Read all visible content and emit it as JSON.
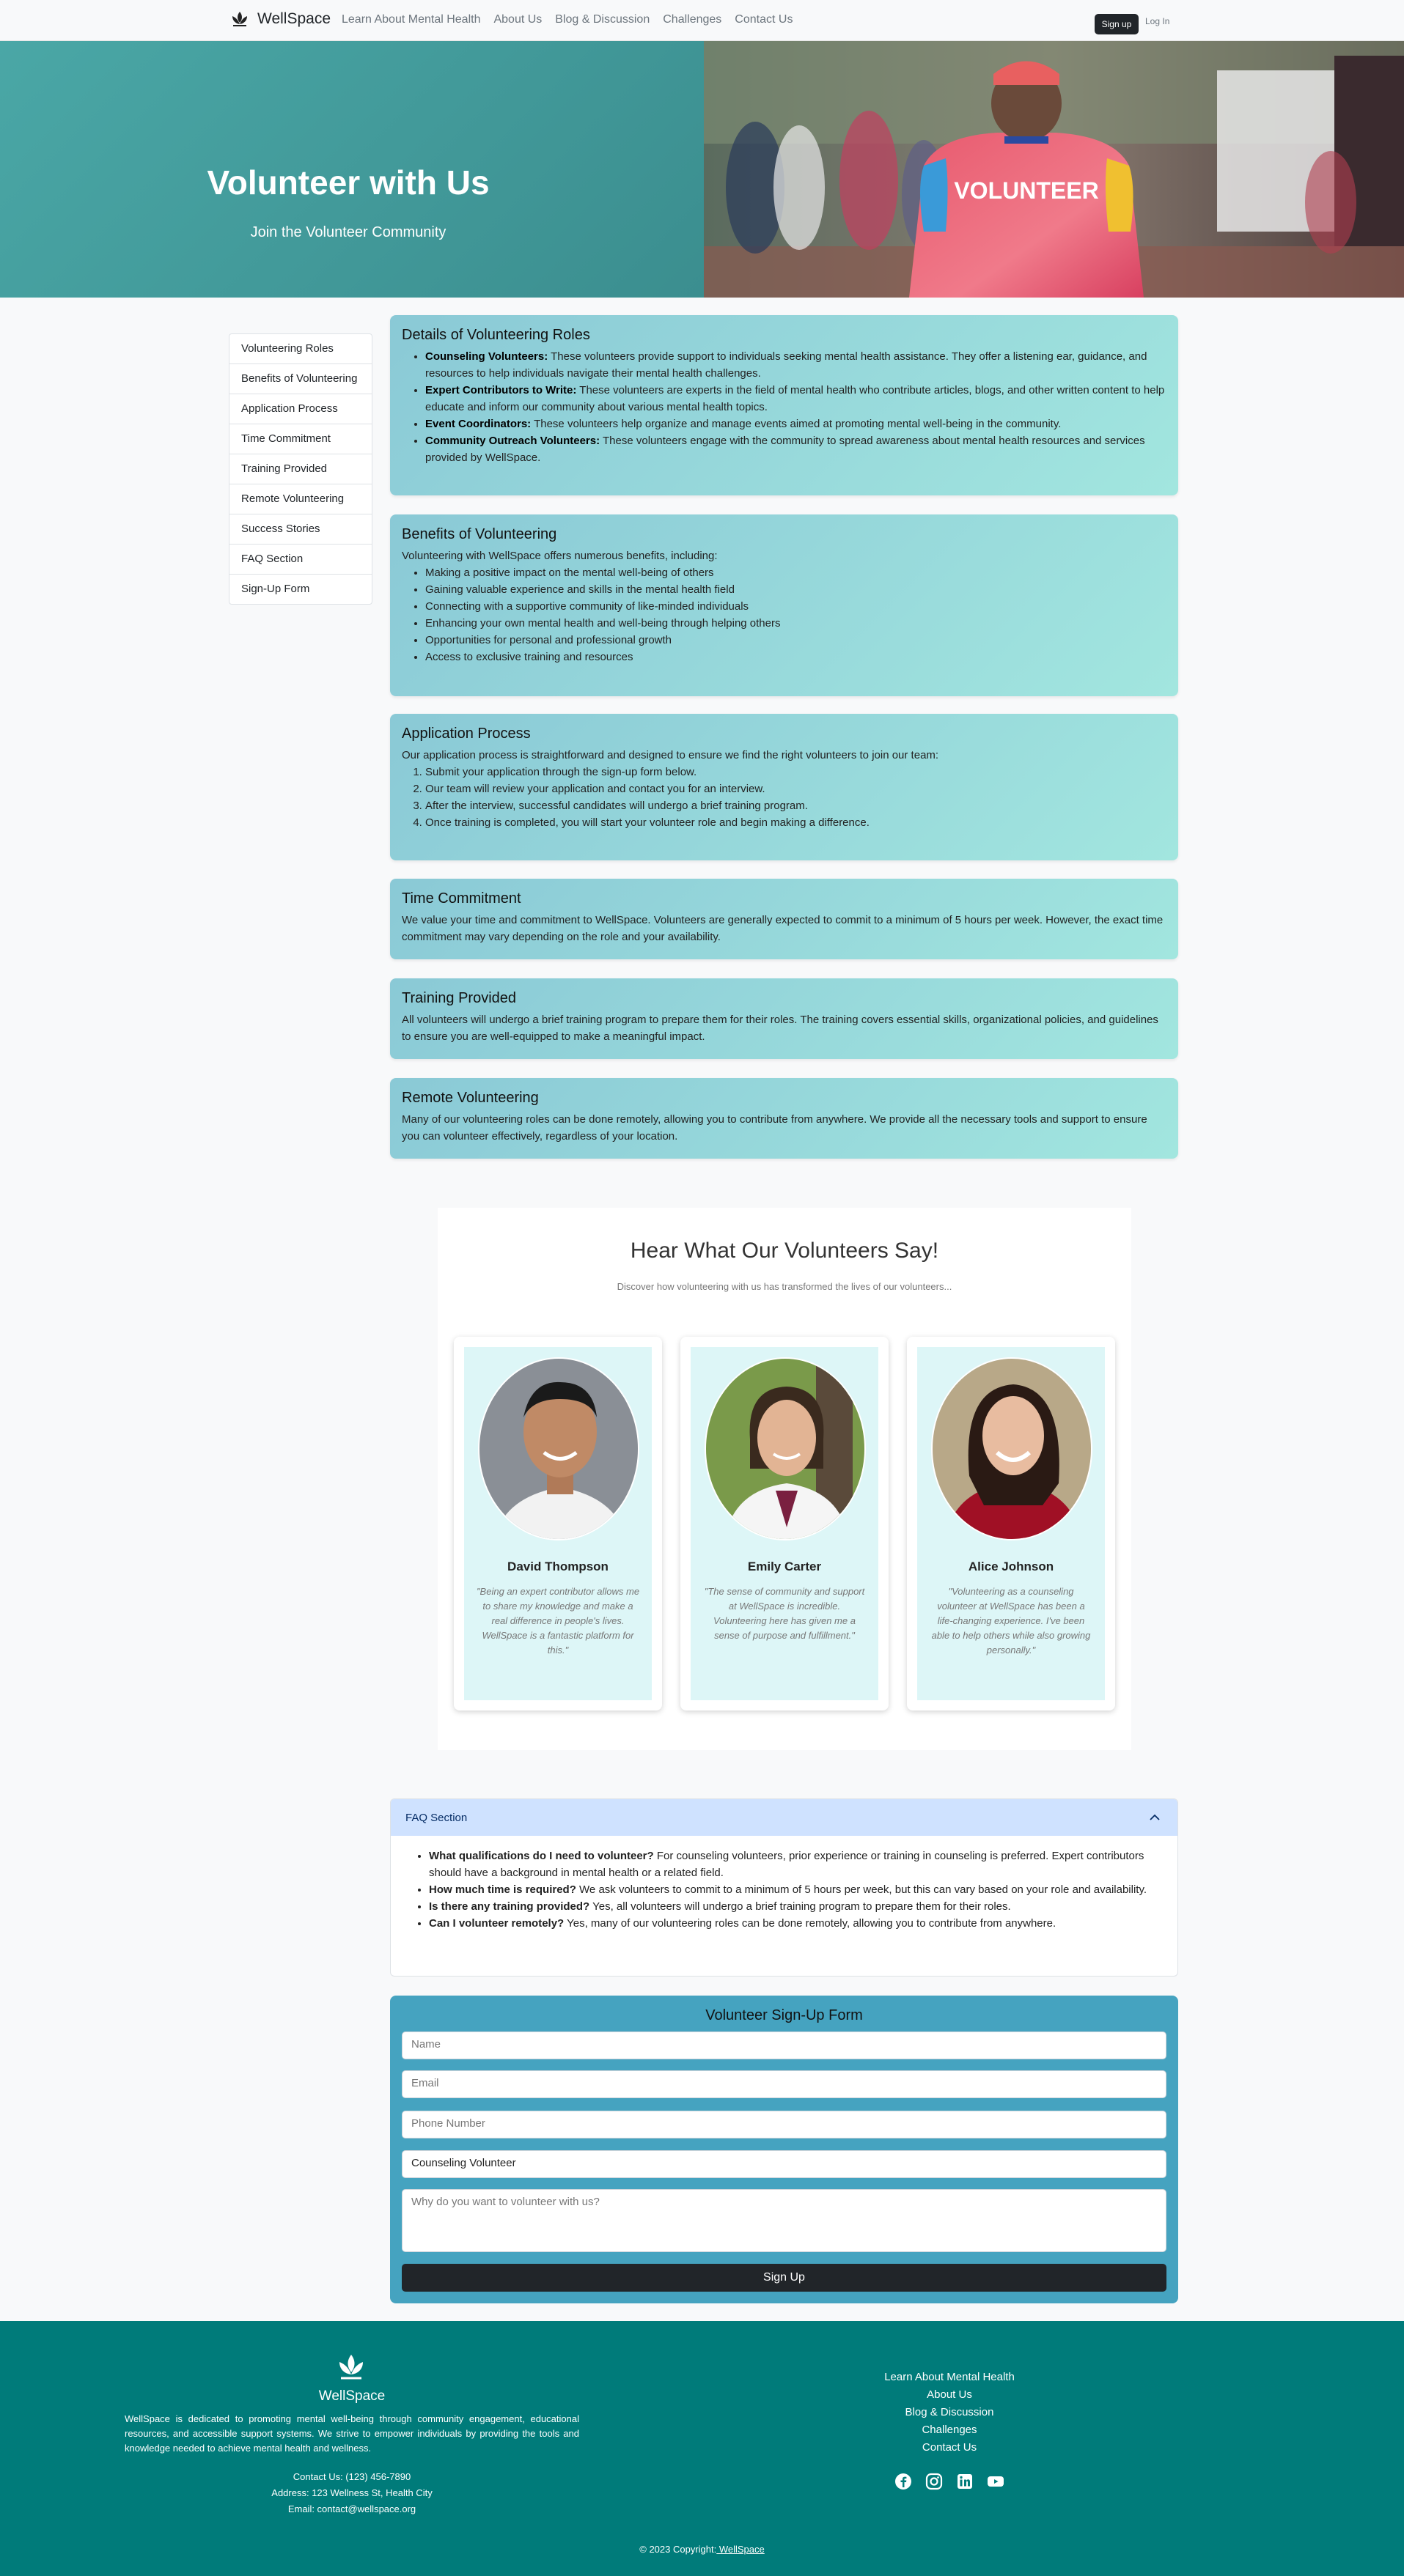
{
  "nav": {
    "brand": "WellSpace",
    "links": [
      "Learn About Mental Health",
      "About Us",
      "Blog & Discussion",
      "Challenges",
      "Contact Us"
    ],
    "signup": "Sign up",
    "login": "Log In"
  },
  "hero": {
    "title": "Volunteer with Us",
    "subtitle": "Join the Volunteer Community",
    "image_text": "VOLUNTEER"
  },
  "sidebar": [
    "Volunteering Roles",
    "Benefits of Volunteering",
    "Application Process",
    "Time Commitment",
    "Training Provided",
    "Remote Volunteering",
    "Success Stories",
    "FAQ Section",
    "Sign-Up Form"
  ],
  "roles": {
    "title": "Details of Volunteering Roles",
    "items": [
      {
        "term": "Counseling Volunteers:",
        "text": " These volunteers provide support to individuals seeking mental health assistance. They offer a listening ear, guidance, and resources to help individuals navigate their mental health challenges."
      },
      {
        "term": "Expert Contributors to Write:",
        "text": " These volunteers are experts in the field of mental health who contribute articles, blogs, and other written content to help educate and inform our community about various mental health topics."
      },
      {
        "term": "Event Coordinators:",
        "text": " These volunteers help organize and manage events aimed at promoting mental well-being in the community."
      },
      {
        "term": "Community Outreach Volunteers:",
        "text": " These volunteers engage with the community to spread awareness about mental health resources and services provided by WellSpace."
      }
    ]
  },
  "benefits": {
    "title": "Benefits of Volunteering",
    "intro": "Volunteering with WellSpace offers numerous benefits, including:",
    "items": [
      "Making a positive impact on the mental well-being of others",
      "Gaining valuable experience and skills in the mental health field",
      "Connecting with a supportive community of like-minded individuals",
      "Enhancing your own mental health and well-being through helping others",
      "Opportunities for personal and professional growth",
      "Access to exclusive training and resources"
    ]
  },
  "process": {
    "title": "Application Process",
    "intro": "Our application process is straightforward and designed to ensure we find the right volunteers to join our team:",
    "steps": [
      "Submit your application through the sign-up form below.",
      "Our team will review your application and contact you for an interview.",
      "After the interview, successful candidates will undergo a brief training program.",
      "Once training is completed, you will start your volunteer role and begin making a difference."
    ]
  },
  "time": {
    "title": "Time Commitment",
    "text": "We value your time and commitment to WellSpace. Volunteers are generally expected to commit to a minimum of 5 hours per week. However, the exact time commitment may vary depending on the role and your availability."
  },
  "training": {
    "title": "Training Provided",
    "text": "All volunteers will undergo a brief training program to prepare them for their roles. The training covers essential skills, organizational policies, and guidelines to ensure you are well-equipped to make a meaningful impact."
  },
  "remote": {
    "title": "Remote Volunteering",
    "text": "Many of our volunteering roles can be done remotely, allowing you to contribute from anywhere. We provide all the necessary tools and support to ensure you can volunteer effectively, regardless of your location."
  },
  "testimonials": {
    "title": "Hear What Our Volunteers Say!",
    "subtitle": "Discover how volunteering with us has transformed the lives of our volunteers...",
    "people": [
      {
        "name": "David Thompson",
        "quote": "\"Being an expert contributor allows me to share my knowledge and make a real difference in people's lives. WellSpace is a fantastic platform for this.\""
      },
      {
        "name": "Emily Carter",
        "quote": "\"The sense of community and support at WellSpace is incredible. Volunteering here has given me a sense of purpose and fulfillment.\""
      },
      {
        "name": "Alice Johnson",
        "quote": "\"Volunteering as a counseling volunteer at WellSpace has been a life-changing experience. I've been able to help others while also growing personally.\""
      }
    ]
  },
  "faq": {
    "title": "FAQ Section",
    "items": [
      {
        "q": "What qualifications do I need to volunteer?",
        "a": " For counseling volunteers, prior experience or training in counseling is preferred. Expert contributors should have a background in mental health or a related field."
      },
      {
        "q": "How much time is required?",
        "a": " We ask volunteers to commit to a minimum of 5 hours per week, but this can vary based on your role and availability."
      },
      {
        "q": "Is there any training provided?",
        "a": " Yes, all volunteers will undergo a brief training program to prepare them for their roles."
      },
      {
        "q": "Can I volunteer remotely?",
        "a": " Yes, many of our volunteering roles can be done remotely, allowing you to contribute from anywhere."
      }
    ]
  },
  "form": {
    "title": "Volunteer Sign-Up Form",
    "name_ph": "Name",
    "email_ph": "Email",
    "phone_ph": "Phone Number",
    "role_value": "Counseling Volunteer",
    "reason_ph": "Why do you want to volunteer with us?",
    "submit": "Sign Up"
  },
  "footer": {
    "name": "WellSpace",
    "desc": "WellSpace is dedicated to promoting mental well-being through community engagement, educational resources, and accessible support systems. We strive to empower individuals by providing the tools and knowledge needed to achieve mental health and wellness.",
    "phone": "Contact Us: (123) 456-7890",
    "address": "Address: 123 Wellness St, Health City",
    "email": "Email: contact@wellspace.org",
    "links": [
      "Learn About Mental Health",
      "About Us",
      "Blog & Discussion",
      "Challenges",
      "Contact Us"
    ],
    "copyright": "© 2023 Copyright:",
    "copyright_link": " WellSpace"
  }
}
